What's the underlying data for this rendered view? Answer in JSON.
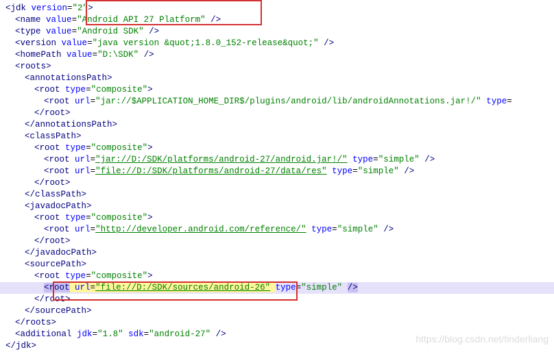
{
  "watermark": "https://blog.csdn.net/tinderliang",
  "jdk": {
    "versionAttr": "version",
    "versionVal": "\"2\""
  },
  "name": {
    "tag": "name",
    "attr": "value",
    "val": "\"Android API 27 Platform\""
  },
  "type": {
    "tag": "type",
    "attr": "value",
    "val": "\"Android SDK\""
  },
  "version": {
    "tag": "version",
    "attr": "value",
    "val": "\"java version &quot;1.8.0_152-release&quot;\""
  },
  "homePath": {
    "tag": "homePath",
    "attr": "value",
    "val": "\"D:\\SDK\""
  },
  "roots": {
    "open": "roots",
    "close": "roots"
  },
  "annotationsPath": {
    "open": "annotationsPath",
    "close": "annotationsPath"
  },
  "composite": {
    "tag": "root",
    "attr": "type",
    "val": "\"composite\""
  },
  "rootClose": "root",
  "annotRoot": {
    "tag": "root",
    "urlAttr": "url",
    "urlVal": "\"jar://$APPLICATION_HOME_DIR$/plugins/android/lib/androidAnnotations.jar!/\"",
    "typeAttr": "type",
    "typeTail": "="
  },
  "classPath": {
    "open": "classPath",
    "close": "classPath"
  },
  "classRoot1": {
    "tag": "root",
    "urlAttr": "url",
    "urlVal": "\"jar://D:/SDK/platforms/android-27/android.jar!/\"",
    "typeAttr": "type",
    "typeVal": "\"simple\""
  },
  "classRoot2": {
    "tag": "root",
    "urlAttr": "url",
    "urlVal": "\"file://D:/SDK/platforms/android-27/data/res\"",
    "typeAttr": "type",
    "typeVal": "\"simple\""
  },
  "javadocPath": {
    "open": "javadocPath",
    "close": "javadocPath"
  },
  "javadocRoot": {
    "tag": "root",
    "urlAttr": "url",
    "urlVal": "\"http://developer.android.com/reference/\"",
    "typeAttr": "type",
    "typeVal": "\"simple\""
  },
  "sourcePath": {
    "open": "sourcePath",
    "close": "sourcePath"
  },
  "sourceRoot": {
    "tag": "root",
    "urlAttr": "url",
    "urlVal": "\"file://D:/SDK/sources/android-26\"",
    "typeAttr": "type",
    "typeVal": "\"simple\""
  },
  "additional": {
    "tag": "additional",
    "jdkAttr": "jdk",
    "jdkVal": "\"1.8\"",
    "sdkAttr": "sdk",
    "sdkVal": "\"android-27\""
  },
  "jdkClose": "jdk"
}
